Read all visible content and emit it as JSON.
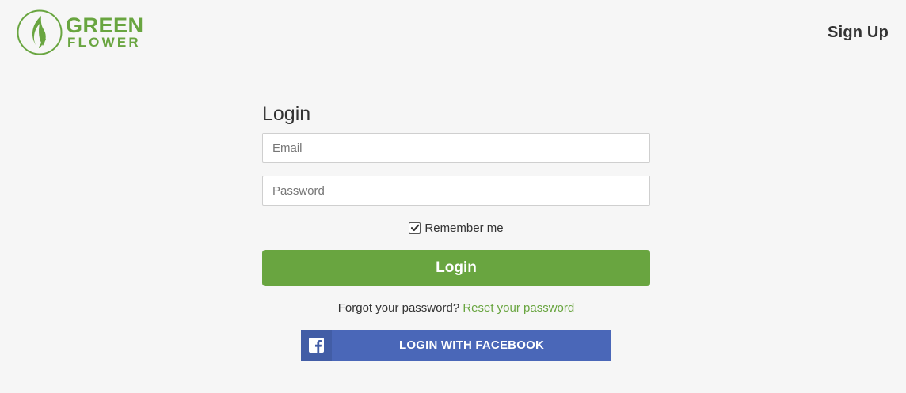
{
  "brand": {
    "name_line1": "GREEN",
    "name_line2": "FLOWER",
    "logo_icon": "leaf-flame-icon",
    "color": "#69a540"
  },
  "header": {
    "signup_label": "Sign Up"
  },
  "form": {
    "title": "Login",
    "email_placeholder": "Email",
    "email_value": "",
    "password_placeholder": "Password",
    "password_value": "",
    "remember_label": "Remember me",
    "remember_checked": true,
    "submit_label": "Login",
    "forgot_text": "Forgot your password?",
    "reset_link_label": "Reset your password"
  },
  "facebook": {
    "label": "LOGIN WITH FACEBOOK",
    "icon": "facebook-icon",
    "color": "#4a67b8"
  },
  "colors": {
    "accent": "#69a540",
    "background": "#f6f6f6",
    "facebook": "#4a67b8"
  }
}
